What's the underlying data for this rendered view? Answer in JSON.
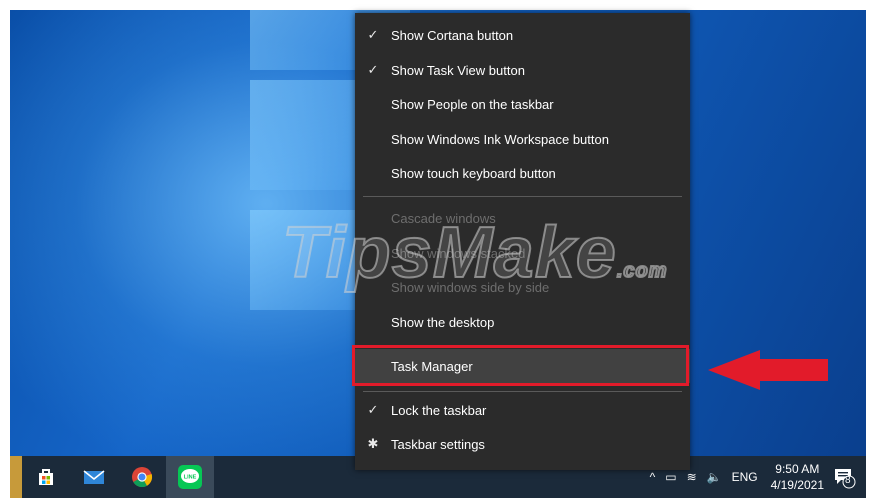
{
  "menu": {
    "items": [
      {
        "label": "Show Cortana button",
        "checked": true,
        "disabled": false
      },
      {
        "label": "Show Task View button",
        "checked": true,
        "disabled": false
      },
      {
        "label": "Show People on the taskbar",
        "checked": false,
        "disabled": false
      },
      {
        "label": "Show Windows Ink Workspace button",
        "checked": false,
        "disabled": false
      },
      {
        "label": "Show touch keyboard button",
        "checked": false,
        "disabled": false
      },
      {
        "label": "Cascade windows",
        "checked": false,
        "disabled": true
      },
      {
        "label": "Show windows stacked",
        "checked": false,
        "disabled": true
      },
      {
        "label": "Show windows side by side",
        "checked": false,
        "disabled": true
      },
      {
        "label": "Show the desktop",
        "checked": false,
        "disabled": false
      },
      {
        "label": "Task Manager",
        "checked": false,
        "disabled": false,
        "highlighted": true
      },
      {
        "label": "Lock the taskbar",
        "checked": true,
        "disabled": false
      },
      {
        "label": "Taskbar settings",
        "icon": "gear-icon",
        "disabled": false
      }
    ],
    "check_glyph": "✓",
    "gear_glyph": "✱"
  },
  "watermark": {
    "main": "TipsMake",
    "suffix": ".com"
  },
  "taskbar": {
    "apps": [
      "store-icon",
      "mail-icon",
      "chrome-icon",
      "line-icon"
    ],
    "line_label": "LINE",
    "tray": {
      "chevron": "^",
      "battery": "▭",
      "wifi": "≋",
      "volume": "🔈",
      "language": "ENG",
      "time": "9:50 AM",
      "date": "4/19/2021",
      "notification_count": "8"
    }
  },
  "colors": {
    "highlight_border": "#e21b2a",
    "menu_bg": "#2b2b2b",
    "arrow": "#e21b2a"
  }
}
